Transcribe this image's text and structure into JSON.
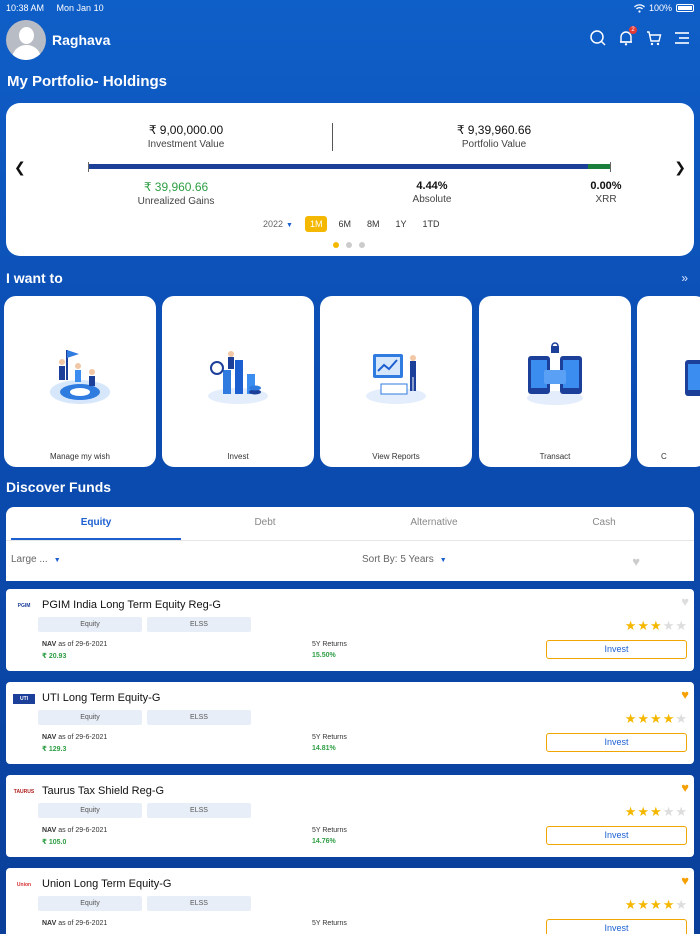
{
  "status_bar": {
    "time": "10:38 AM",
    "date": "Mon Jan 10",
    "battery": "100%"
  },
  "header": {
    "user_name": "Raghava",
    "notification_count": "2"
  },
  "page_title": "My Portfolio-  Holdings",
  "portfolio": {
    "investment_amount": "₹  9,00,000.00",
    "investment_label": "Investment Value",
    "portfolio_amount": "₹  9,39,960.66",
    "portfolio_label": "Portfolio Value",
    "invested_fraction": 0.957,
    "gains_amount": "₹  39,960.66",
    "gains_label": "Unrealized Gains",
    "absolute_value": "4.44%",
    "absolute_label": "Absolute",
    "xrr_value": "0.00%",
    "xrr_label": "XRR",
    "year": "2022",
    "periods": [
      "1M",
      "6M",
      "8M",
      "1Y",
      "1TD"
    ],
    "active_period": "1M"
  },
  "i_want_to": {
    "title": "I want to",
    "actions": [
      "Manage my wish",
      "Invest",
      "View Reports",
      "Transact",
      "C"
    ]
  },
  "discover": {
    "title": "Discover Funds",
    "tabs": [
      "Equity",
      "Debt",
      "Alternative",
      "Cash"
    ],
    "filter_value": "Large ...",
    "sort_label": "Sort By: 5 Years"
  },
  "funds": [
    {
      "logo": "PGIM",
      "name": "PGIM India Long Term Equity Reg-G",
      "tags": [
        "Equity",
        "ELSS"
      ],
      "nav_label": "NAV",
      "nav_date": "as of 29-6-2021",
      "nav_value": "₹ 20.93",
      "returns_label": "5Y Returns",
      "returns_value": "15.50%",
      "rating": 3,
      "favourite": false,
      "invest_label": "Invest"
    },
    {
      "logo": "UTI",
      "name": "UTI Long Term Equity-G",
      "tags": [
        "Equity",
        "ELSS"
      ],
      "nav_label": "NAV",
      "nav_date": "as of 29-6-2021",
      "nav_value": "₹ 129.3",
      "returns_label": "5Y Returns",
      "returns_value": "14.81%",
      "rating": 4,
      "favourite": true,
      "invest_label": "Invest"
    },
    {
      "logo": "TAURUS",
      "name": "Taurus Tax Shield Reg-G",
      "tags": [
        "Equity",
        "ELSS"
      ],
      "nav_label": "NAV",
      "nav_date": "as of 29-6-2021",
      "nav_value": "₹ 105.0",
      "returns_label": "5Y Returns",
      "returns_value": "14.76%",
      "rating": 3,
      "favourite": true,
      "invest_label": "Invest"
    },
    {
      "logo": "Union",
      "name": "Union Long Term Equity-G",
      "tags": [
        "Equity",
        "ELSS"
      ],
      "nav_label": "NAV",
      "nav_date": "as of 29-6-2021",
      "nav_value": "",
      "returns_label": "5Y Returns",
      "returns_value": "",
      "rating": 4,
      "favourite": true,
      "invest_label": "Invest"
    }
  ],
  "colors": {
    "primary": "#1c5fd1",
    "accent": "#f5b800",
    "gain": "#2e9e44",
    "fav": "#f5a000"
  }
}
